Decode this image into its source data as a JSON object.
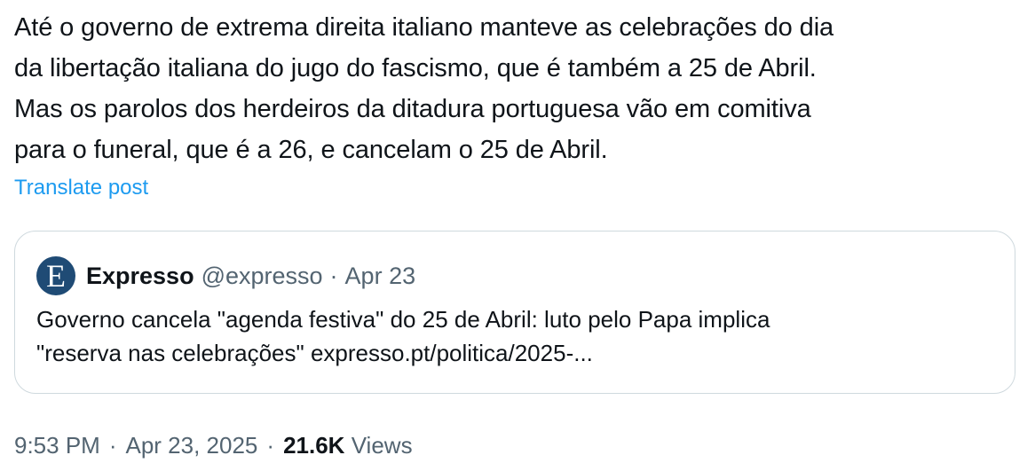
{
  "post": {
    "lines": [
      "Até o governo de extrema direita italiano manteve as celebrações do dia",
      "da libertação italiana do jugo do fascismo, que é também a 25 de Abril.",
      "Mas os parolos dos herdeiros da ditadura portuguesa vão em comitiva",
      "para o funeral, que é a 26, e cancelam o 25 de Abril."
    ],
    "translate_label": "Translate post"
  },
  "quote": {
    "avatar_letter": "E",
    "avatar_color": "#1f4b75",
    "name": "Expresso",
    "handle": "@expresso",
    "separator": "·",
    "date": "Apr 23",
    "body_lines": [
      "Governo cancela \"agenda festiva\" do 25 de Abril: luto pelo Papa implica",
      "\"reserva nas celebrações\" expresso.pt/politica/2025-..."
    ]
  },
  "meta": {
    "time": "9:53 PM",
    "separator": "·",
    "date": "Apr 23, 2025",
    "views_count": "21.6K",
    "views_label": "Views"
  },
  "colors": {
    "text": "#0f1419",
    "secondary": "#536471",
    "link": "#1d9bf0",
    "border": "#cfd9de"
  }
}
